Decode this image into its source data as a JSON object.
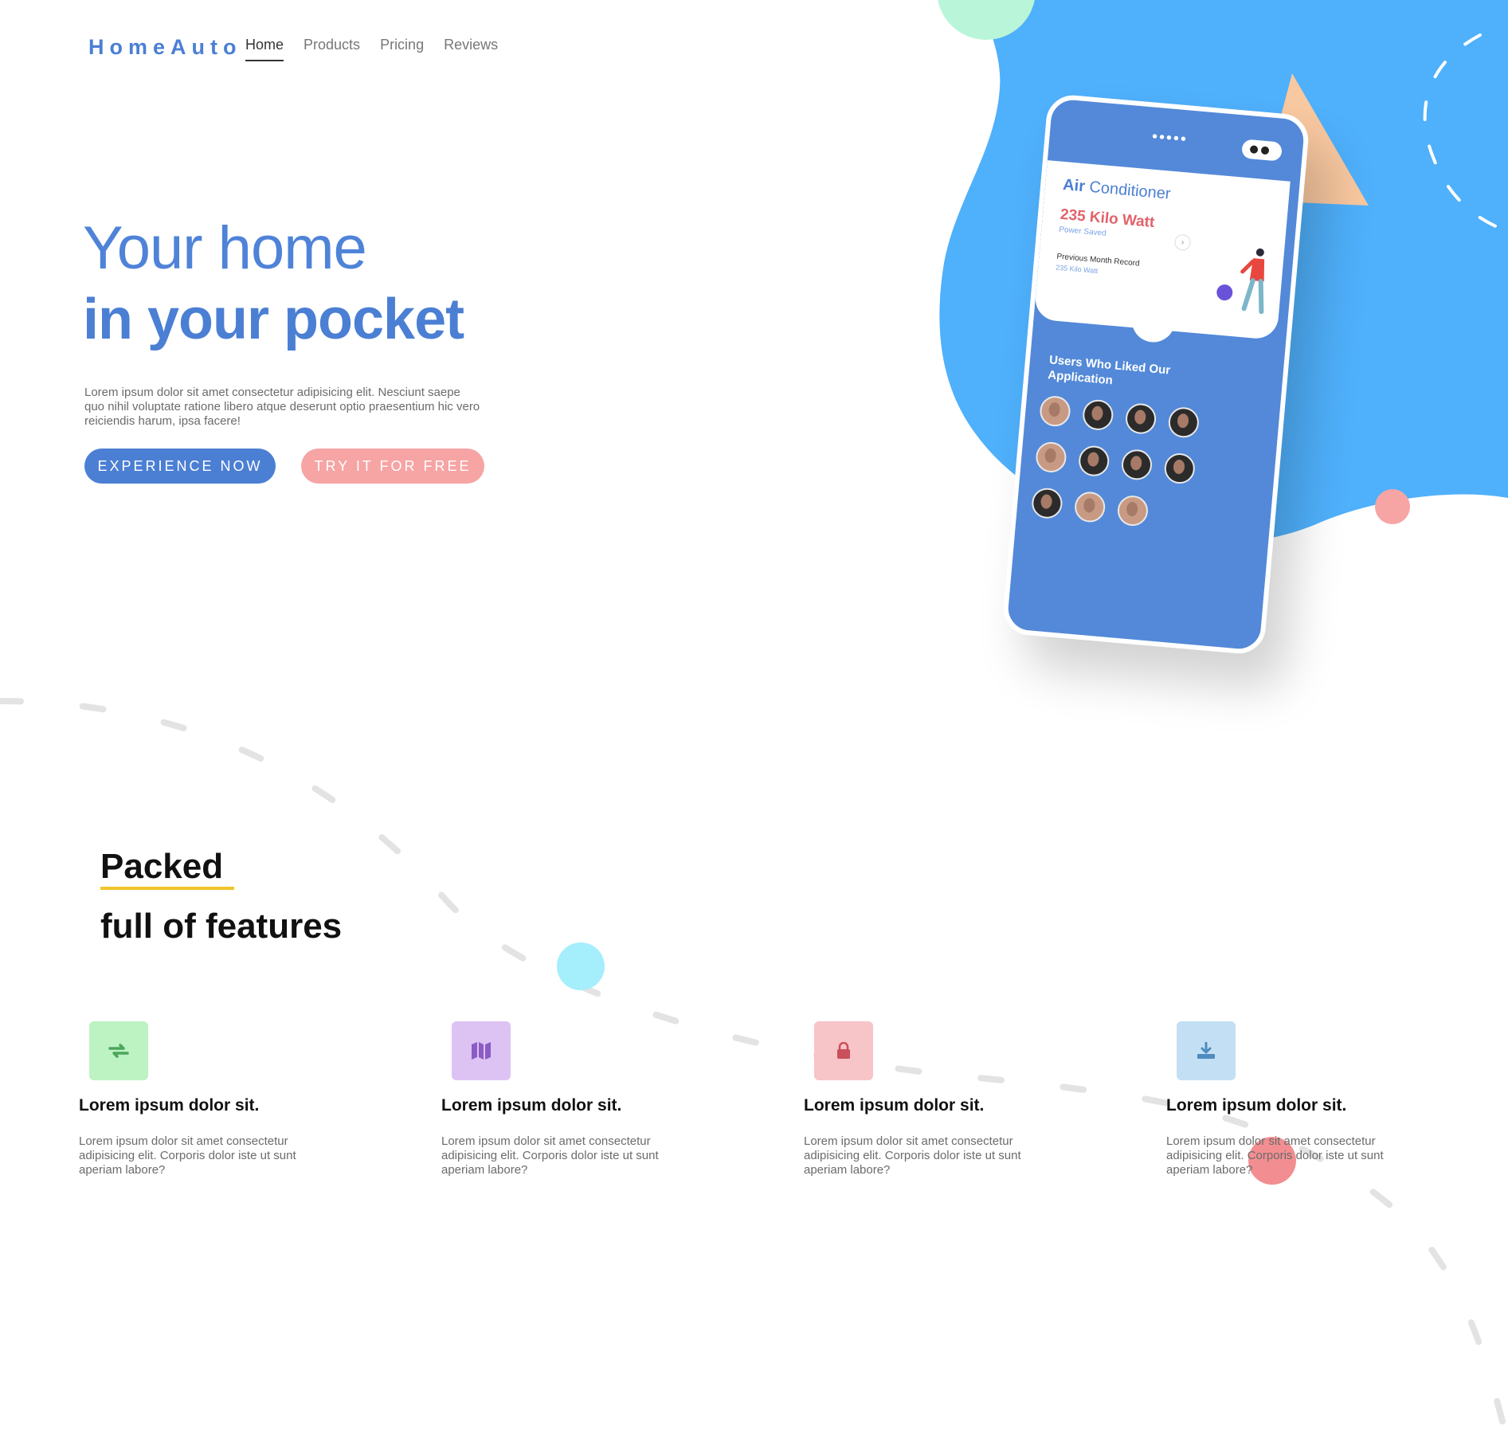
{
  "brand": {
    "logo": "HomeAuto"
  },
  "nav": {
    "items": [
      {
        "label": "Home",
        "active": true
      },
      {
        "label": "Products",
        "active": false
      },
      {
        "label": "Pricing",
        "active": false
      },
      {
        "label": "Reviews",
        "active": false
      }
    ]
  },
  "hero": {
    "line1": "Your home",
    "line2": "in your pocket",
    "description": "Lorem ipsum dolor sit amet consectetur adipisicing elit. Nesciunt saepe quo nihil voluptate ratione libero atque deserunt optio praesentium hic vero reiciendis harum, ipsa facere!",
    "primary_button": "EXPERIENCE NOW",
    "secondary_button": "TRY IT FOR FREE"
  },
  "phone": {
    "dots": "•••••",
    "card_title_bold": "Air",
    "card_title_rest": "Conditioner",
    "stat": "235 Kilo Watt",
    "stat_sub": "Power Saved",
    "arrow": "›",
    "previous_label": "Previous Month Record",
    "previous_value": "235 Kilo Watt",
    "users_heading": "Users Who Liked Our Application"
  },
  "features_section": {
    "heading_line1": "Packed",
    "heading_line2": "full of features",
    "items": [
      {
        "icon": "repeat-icon",
        "color": "#bdf2c2",
        "icon_color": "#4aa65a",
        "title": "Lorem ipsum dolor sit.",
        "text": "Lorem ipsum dolor sit amet consectetur adipisicing elit. Corporis dolor iste ut sunt aperiam labore?"
      },
      {
        "icon": "map-icon",
        "color": "#ddc3f3",
        "icon_color": "#8a5cc4",
        "title": "Lorem ipsum dolor sit.",
        "text": "Lorem ipsum dolor sit amet consectetur adipisicing elit. Corporis dolor iste ut sunt aperiam labore?"
      },
      {
        "icon": "lock-icon",
        "color": "#f7c4c8",
        "icon_color": "#c9505a",
        "title": "Lorem ipsum dolor sit.",
        "text": "Lorem ipsum dolor sit amet consectetur adipisicing elit. Corporis dolor iste ut sunt aperiam labore?"
      },
      {
        "icon": "download-icon",
        "color": "#c3dff3",
        "icon_color": "#4e8cbf",
        "title": "Lorem ipsum dolor sit.",
        "text": "Lorem ipsum dolor sit amet consectetur adipisicing elit. Corporis dolor iste ut sunt aperiam labore?"
      }
    ]
  },
  "colors": {
    "brand_blue": "#4b7fd4",
    "blob_blue": "#4fb0fb",
    "accent_pink": "#f6a4a4",
    "underline_yellow": "#f2c42c"
  }
}
